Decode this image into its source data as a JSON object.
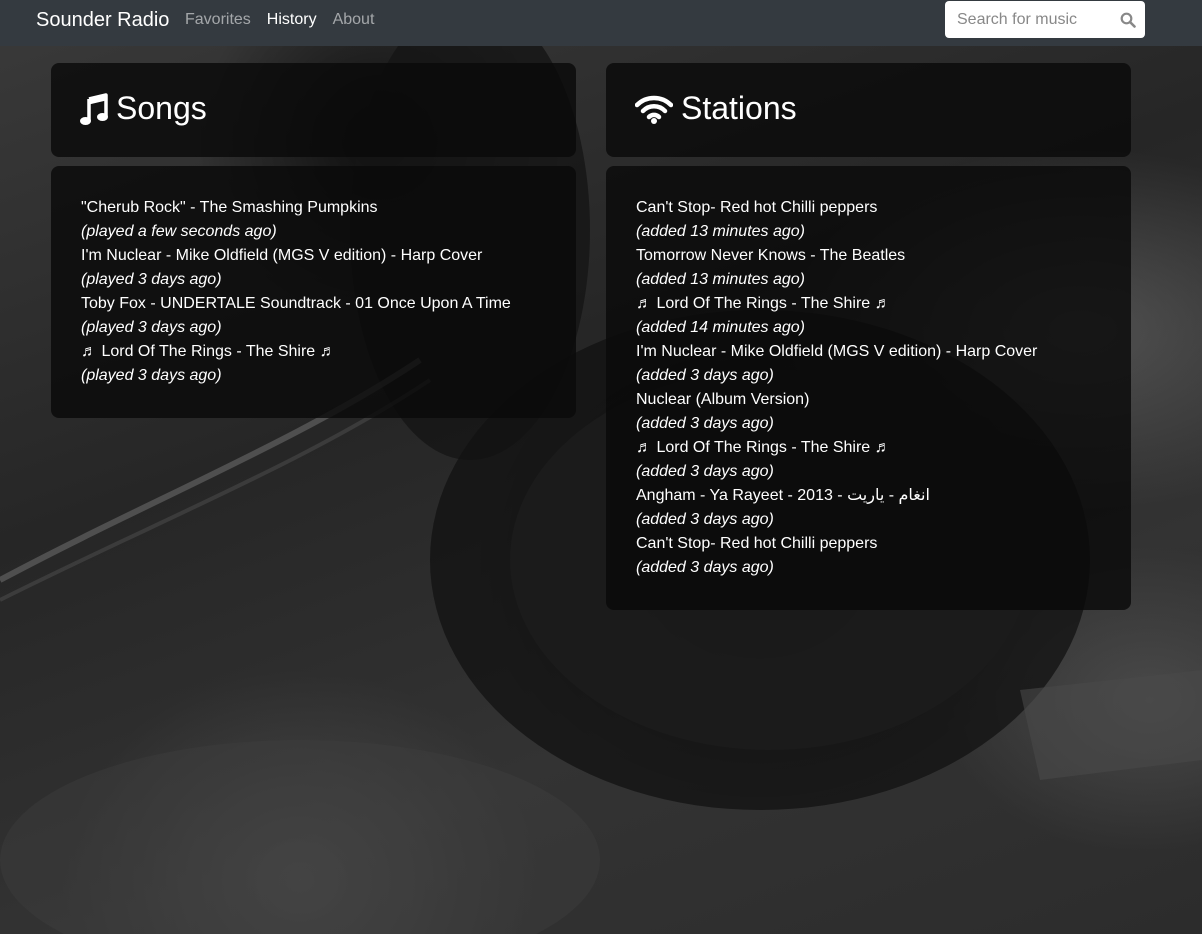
{
  "navbar": {
    "brand": "Sounder Radio",
    "links": [
      {
        "label": "Favorites",
        "active": false
      },
      {
        "label": "History",
        "active": true
      },
      {
        "label": "About",
        "active": false
      }
    ],
    "search": {
      "placeholder": "Search for music",
      "value": "",
      "icon": "search-icon"
    }
  },
  "songs": {
    "icon": "music-note-icon",
    "title": "Songs",
    "items": [
      {
        "name": "\"Cherub Rock\" - The Smashing Pumpkins",
        "time": "(played a few seconds ago)"
      },
      {
        "name": "I'm Nuclear - Mike Oldfield (MGS V edition) - Harp Cover",
        "time": "(played 3 days ago)"
      },
      {
        "name": "Toby Fox - UNDERTALE Soundtrack - 01 Once Upon A Time",
        "time": "(played 3 days ago)"
      },
      {
        "name": "♬ Lord Of The Rings - The Shire ♬",
        "time": "(played 3 days ago)"
      }
    ]
  },
  "stations": {
    "icon": "wifi-icon",
    "title": "Stations",
    "items": [
      {
        "name": "Can't Stop- Red hot Chilli peppers",
        "time": "(added 13 minutes ago)"
      },
      {
        "name": "Tomorrow Never Knows - The Beatles",
        "time": "(added 13 minutes ago)"
      },
      {
        "name": "♬ Lord Of The Rings - The Shire ♬",
        "time": "(added 14 minutes ago)"
      },
      {
        "name": "I'm Nuclear - Mike Oldfield (MGS V edition) - Harp Cover",
        "time": "(added 3 days ago)"
      },
      {
        "name": "Nuclear (Album Version)",
        "time": "(added 3 days ago)"
      },
      {
        "name": "♬ Lord Of The Rings - The Shire ♬",
        "time": "(added 3 days ago)"
      },
      {
        "name": "Angham - Ya Rayeet - 2013 - انغام - ياريت",
        "time": "(added 3 days ago)"
      },
      {
        "name": "Can't Stop- Red hot Chilli peppers",
        "time": "(added 3 days ago)"
      }
    ]
  },
  "colors": {
    "navbar": "#343a40",
    "panel": "#0a0a0a",
    "text": "#ffffff",
    "nav_inactive": "#9a9da0"
  }
}
